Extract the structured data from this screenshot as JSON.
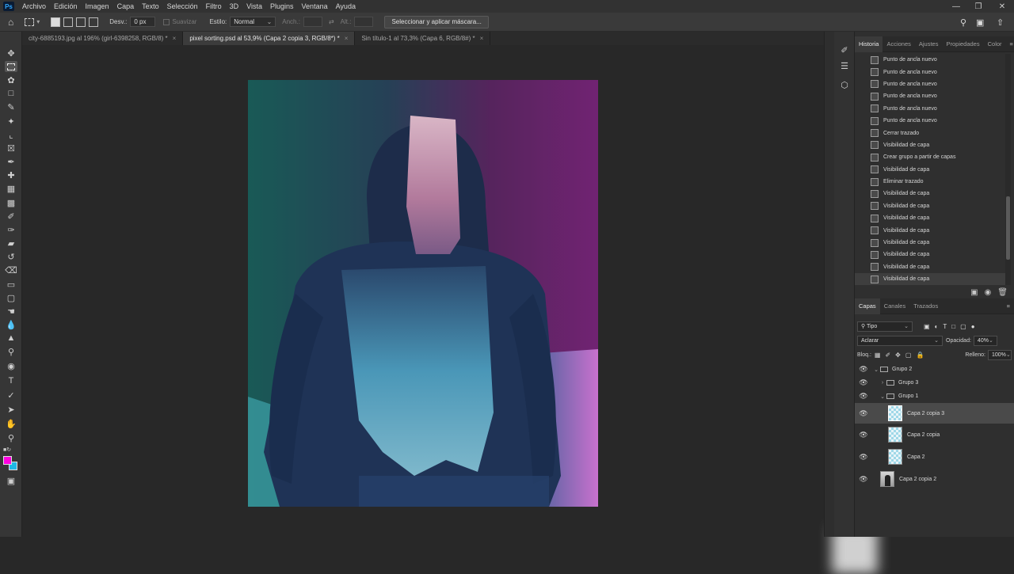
{
  "menubar": {
    "logo": "Ps",
    "items": [
      "Archivo",
      "Edición",
      "Imagen",
      "Capa",
      "Texto",
      "Selección",
      "Filtro",
      "3D",
      "Vista",
      "Plugins",
      "Ventana",
      "Ayuda"
    ]
  },
  "options_bar": {
    "feather_label": "Desv.:",
    "feather_value": "0 px",
    "smooth_label": "Suavizar",
    "style_label": "Estilo:",
    "style_value": "Normal",
    "width_label": "Anch.:",
    "height_label": "Alt.:",
    "mask_button": "Seleccionar y aplicar máscara..."
  },
  "tabs": [
    {
      "label": "city-6885193.jpg al 196% (girl-6398258, RGB/8) *"
    },
    {
      "label": "pixel sorting.psd al 53,9% (Capa 2 copia 3, RGB/8*) *"
    },
    {
      "label": "Sin título-1 al 73,3% (Capa 6, RGB/8#) *"
    }
  ],
  "history_panel": {
    "tabs": [
      "Historia",
      "Acciones",
      "Ajustes",
      "Propiedades",
      "Color"
    ],
    "items": [
      "Punto de ancla nuevo",
      "Punto de ancla nuevo",
      "Punto de ancla nuevo",
      "Punto de ancla nuevo",
      "Punto de ancla nuevo",
      "Punto de ancla nuevo",
      "Cerrar trazado",
      "Visibilidad de capa",
      "Crear grupo a partir de capas",
      "Visibilidad de capa",
      "Eliminar trazado",
      "Visibilidad de capa",
      "Visibilidad de capa",
      "Visibilidad de capa",
      "Visibilidad de capa",
      "Visibilidad de capa",
      "Visibilidad de capa",
      "Visibilidad de capa",
      "Visibilidad de capa"
    ]
  },
  "layers_panel": {
    "tabs": [
      "Capas",
      "Canales",
      "Trazados"
    ],
    "filter_value": "Tipo",
    "blend_mode": "Aclarar",
    "opacity_label": "Opacidad:",
    "opacity_value": "40%",
    "lock_label": "Bloq.:",
    "fill_label": "Relleno:",
    "fill_value": "100%",
    "layers": [
      {
        "name": "Grupo 2",
        "type": "group",
        "expanded": true
      },
      {
        "name": "Grupo 3",
        "type": "group",
        "expanded": false
      },
      {
        "name": "Grupo 1",
        "type": "group",
        "expanded": true
      },
      {
        "name": "Capa 2 copia 3",
        "type": "layer",
        "selected": true
      },
      {
        "name": "Capa 2 copia",
        "type": "layer"
      },
      {
        "name": "Capa 2",
        "type": "layer"
      },
      {
        "name": "Capa 2 copia 2",
        "type": "photo"
      }
    ]
  },
  "colors": {
    "foreground": "#ff00e0",
    "background": "#1eb8e6",
    "ps_blue": "#31a8ff"
  }
}
